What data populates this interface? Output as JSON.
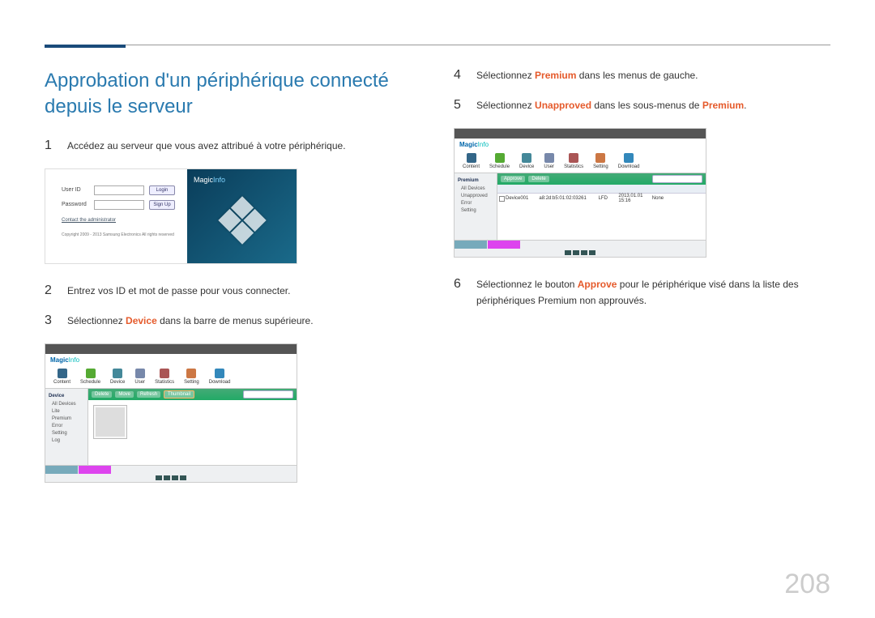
{
  "title": "Approbation d'un périphérique connecté depuis le serveur",
  "steps": {
    "s1": "Accédez au serveur que vous avez attribué à votre périphérique.",
    "s2": "Entrez vos ID et mot de passe pour vous connecter.",
    "s3_pre": "Sélectionnez ",
    "s3_hl": "Device",
    "s3_post": " dans la barre de menus supérieure.",
    "s4_pre": "Sélectionnez ",
    "s4_hl": "Premium",
    "s4_post": " dans les menus de gauche.",
    "s5_pre": "Sélectionnez ",
    "s5_hl": "Unapproved",
    "s5_post": " dans les sous-menus de ",
    "s5_hl2": "Premium",
    "s5_post2": ".",
    "s6_pre": "Sélectionnez le bouton ",
    "s6_hl": "Approve",
    "s6_post": " pour le périphérique visé dans la liste des périphériques Premium non approuvés."
  },
  "step_numbers": {
    "n1": "1",
    "n2": "2",
    "n3": "3",
    "n4": "4",
    "n5": "5",
    "n6": "6"
  },
  "login_shot": {
    "brand_a": "Magic",
    "brand_b": "Info",
    "user_id_label": "User ID",
    "password_label": "Password",
    "login_btn": "Login",
    "signup_btn": "Sign Up",
    "contact": "Contact the administrator",
    "copyright": "Copyright 2009 - 2013 Samsung Electronics All rights reserved"
  },
  "app_shot": {
    "brand_a": "Magic",
    "brand_b": "Info",
    "icons": [
      "Content",
      "Schedule",
      "Device",
      "User",
      "Statistics",
      "Setting",
      "Download"
    ],
    "sidebar_header": "Device",
    "sidebar_items": [
      "All Devices",
      "Lite",
      "Premium",
      "Unapproved",
      "Error",
      "Setting",
      "Log"
    ],
    "toolbar": [
      "Approve",
      "Delete",
      "Move",
      "Refresh"
    ],
    "thumb": "Thumbnail",
    "premium_header": "Premium",
    "premium_sub": "Unapproved",
    "table_row": [
      "",
      "Device001",
      "a8:2d:b5:01:02:03",
      "261",
      "LFD",
      "2013.01.01 15:16",
      "None",
      ""
    ]
  },
  "page_number": "208"
}
